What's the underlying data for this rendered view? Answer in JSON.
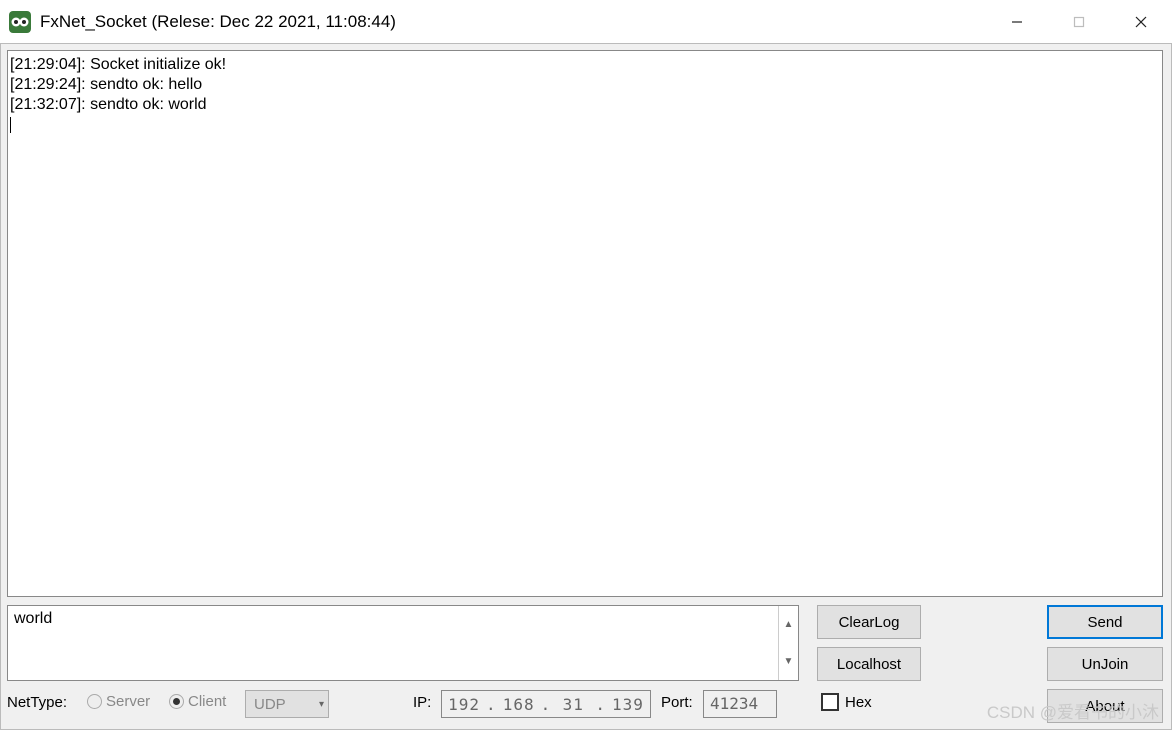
{
  "window": {
    "title": "FxNet_Socket (Relese: Dec 22 2021, 11:08:44)"
  },
  "log": {
    "lines": [
      "[21:29:04]: Socket initialize ok!",
      "[21:29:24]: sendto ok: hello",
      "[21:32:07]: sendto ok: world"
    ]
  },
  "message": {
    "value": "world"
  },
  "buttons": {
    "clearlog": "ClearLog",
    "localhost": "Localhost",
    "send": "Send",
    "unjoin": "UnJoin",
    "about": "About"
  },
  "nettype": {
    "label": "NetType:",
    "server_label": "Server",
    "client_label": "Client",
    "selected": "Client",
    "protocol": "UDP"
  },
  "ip": {
    "label": "IP:",
    "octets": [
      "192",
      "168",
      "31",
      "139"
    ]
  },
  "port": {
    "label": "Port:",
    "value": "41234"
  },
  "hex": {
    "label": "Hex",
    "checked": false
  },
  "watermark": "CSDN @爱看书的小沐"
}
